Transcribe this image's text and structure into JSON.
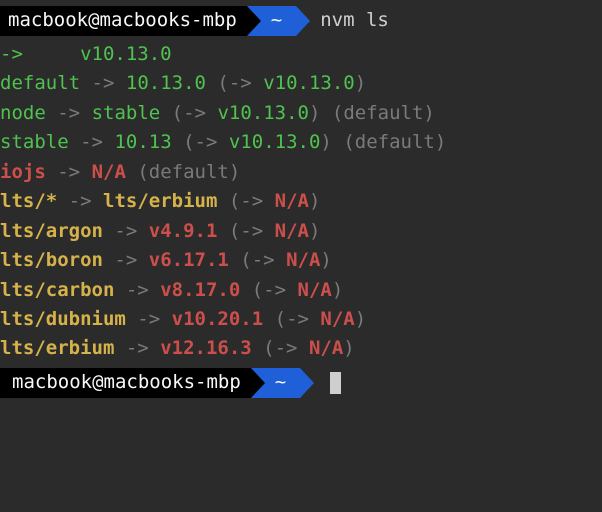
{
  "prompt1": {
    "userhost": "macbook@macbooks-mbp",
    "dir": "~",
    "cmd": "nvm ls"
  },
  "current": {
    "arrow": "->",
    "version": "v10.13.0"
  },
  "a1": {
    "name": "default",
    "arrow": "->",
    "ver": "10.13.0",
    "open": "(",
    "map": "->",
    "tgt": "v10.13.0",
    "close": ")"
  },
  "a2": {
    "name": "node",
    "arrow": "->",
    "ver": "stable",
    "open": "(",
    "map": "->",
    "tgt": "v10.13.0",
    "close": ")",
    "extra": "(default)"
  },
  "a3": {
    "name": "stable",
    "arrow": "->",
    "ver": "10.13",
    "open": "(",
    "map": "->",
    "tgt": "v10.13.0",
    "close": ")",
    "extra": "(default)"
  },
  "io": {
    "name": "iojs",
    "arrow": "->",
    "tgt": "N/A",
    "extra": "(default)"
  },
  "l0": {
    "name": "lts/*",
    "arrow": "->",
    "tgt": "lts/erbium",
    "open": "(",
    "map": "->",
    "v": "N/A",
    "close": ")"
  },
  "l1": {
    "name": "lts/argon",
    "arrow": "->",
    "tgt": "v4.9.1",
    "open": "(",
    "map": "->",
    "v": "N/A",
    "close": ")"
  },
  "l2": {
    "name": "lts/boron",
    "arrow": "->",
    "tgt": "v6.17.1",
    "open": "(",
    "map": "->",
    "v": "N/A",
    "close": ")"
  },
  "l3": {
    "name": "lts/carbon",
    "arrow": "->",
    "tgt": "v8.17.0",
    "open": "(",
    "map": "->",
    "v": "N/A",
    "close": ")"
  },
  "l4": {
    "name": "lts/dubnium",
    "arrow": "->",
    "tgt": "v10.20.1",
    "open": "(",
    "map": "->",
    "v": "N/A",
    "close": ")"
  },
  "l5": {
    "name": "lts/erbium",
    "arrow": "->",
    "tgt": "v12.16.3",
    "open": "(",
    "map": "->",
    "v": "N/A",
    "close": ")"
  },
  "prompt2": {
    "userhost": "macbook@macbooks-mbp",
    "dir": "~"
  }
}
